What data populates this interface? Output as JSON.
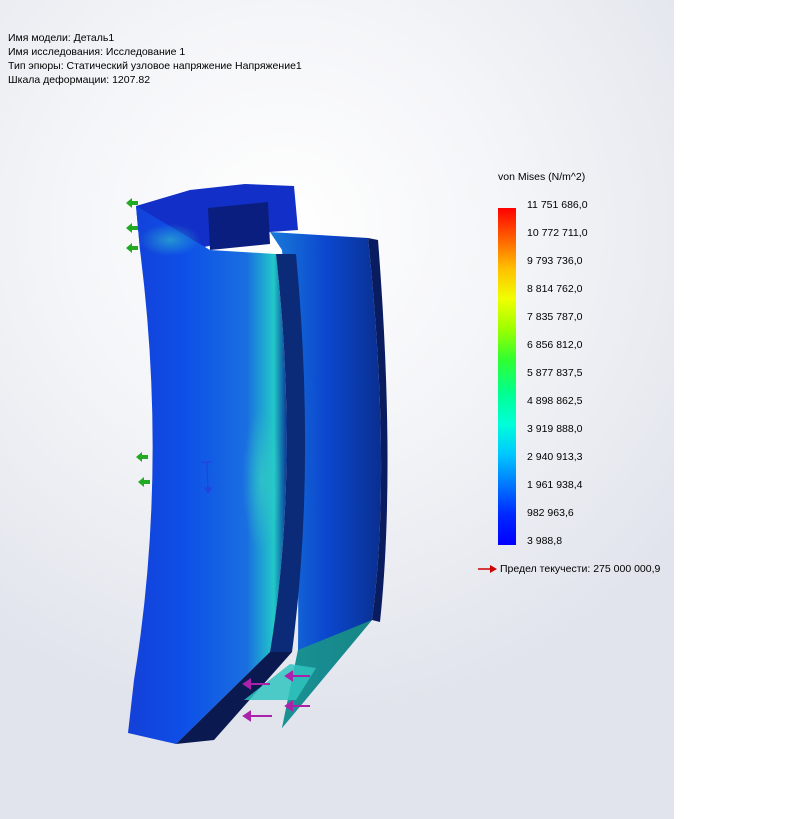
{
  "info": {
    "model_name": "Имя модели: Деталь1",
    "study_name": "Имя  исследования: Исследование 1",
    "plot_type": "Тип эпюры: Статический узловое напряжение Напряжение1",
    "deformation_scale": "Шкала деформации: 1207.82"
  },
  "legend": {
    "title": "von Mises (N/m^2)",
    "ticks": [
      "11 751 686,0",
      "10 772 711,0",
      "9 793 736,0",
      "8 814 762,0",
      "7 835 787,0",
      "6 856 812,0",
      "5 877 837,5",
      "4 898 862,5",
      "3 919 888,0",
      "2 940 913,3",
      "1 961 938,4",
      "982 963,6",
      "3 988,8"
    ],
    "yield_text": "Предел текучести: 275 000 000,9"
  },
  "colors": {
    "max": "#ff0000",
    "min": "#0000ff",
    "fixture": "#22aa22",
    "load": "#aa22aa",
    "yield_arrow": "#cc0000"
  },
  "icons": {
    "fixture": "green-fixture-arrow-icon",
    "load": "magenta-force-arrow-icon",
    "axis": "coordinate-triad-icon"
  }
}
